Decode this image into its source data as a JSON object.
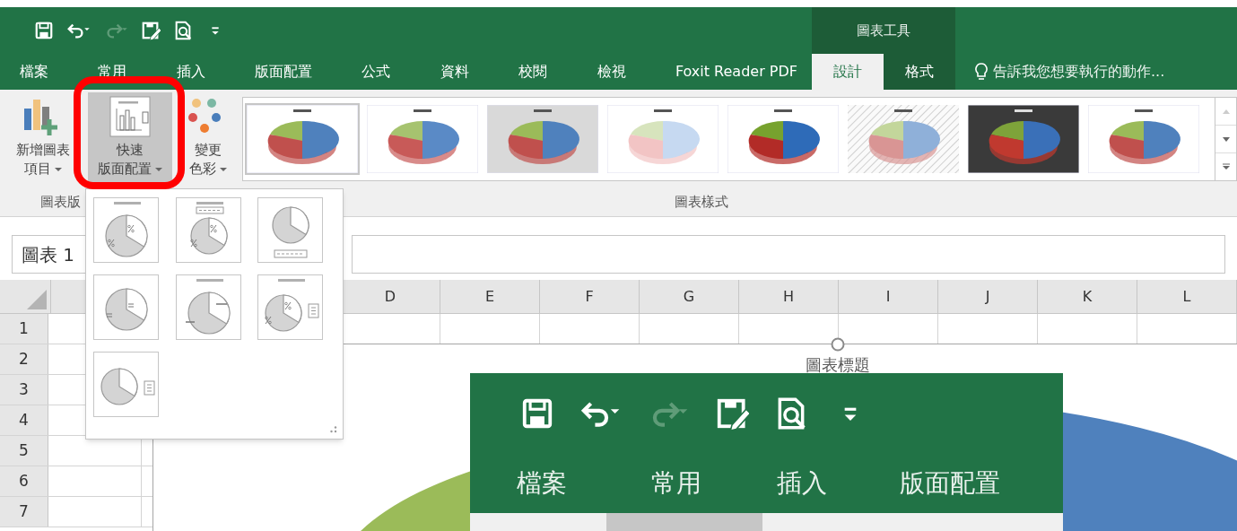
{
  "quick_access": [
    {
      "kind": "save",
      "disabled": false
    },
    {
      "kind": "undo",
      "disabled": false
    },
    {
      "kind": "redo",
      "disabled": true
    },
    {
      "kind": "edit-save",
      "disabled": false
    },
    {
      "kind": "preview",
      "disabled": false
    },
    {
      "kind": "customize",
      "disabled": false
    }
  ],
  "contextual_group": "圖表工具",
  "tabs": [
    {
      "label": "檔案",
      "kind": "normal",
      "selected": false
    },
    {
      "label": "常用",
      "kind": "normal",
      "selected": false
    },
    {
      "label": "插入",
      "kind": "normal",
      "selected": false
    },
    {
      "label": "版面配置",
      "kind": "normal",
      "selected": false
    },
    {
      "label": "公式",
      "kind": "normal",
      "selected": false
    },
    {
      "label": "資料",
      "kind": "normal",
      "selected": false
    },
    {
      "label": "校閱",
      "kind": "normal",
      "selected": false
    },
    {
      "label": "檢視",
      "kind": "normal",
      "selected": false
    },
    {
      "label": "Foxit Reader PDF",
      "kind": "normal",
      "selected": false
    },
    {
      "label": "設計",
      "kind": "contextual",
      "selected": true
    },
    {
      "label": "格式",
      "kind": "contextual",
      "selected": false
    }
  ],
  "tell_me": "告訴我您想要執行的動作...",
  "ribbon_buttons": [
    {
      "kind": "add-element",
      "lines": [
        "新增圖表",
        "項目"
      ],
      "expanded": false
    },
    {
      "kind": "quick-layout",
      "lines": [
        "快速",
        "版面配置"
      ],
      "expanded": true
    },
    {
      "kind": "colors",
      "lines": [
        "變更",
        "色彩"
      ],
      "expanded": false
    }
  ],
  "styles_gallery": [
    {
      "kind": "plain",
      "selected": true
    },
    {
      "kind": "labels",
      "selected": false
    },
    {
      "kind": "gradient",
      "selected": false
    },
    {
      "kind": "pastel",
      "selected": false
    },
    {
      "kind": "bold",
      "selected": false
    },
    {
      "kind": "striped",
      "selected": false
    },
    {
      "kind": "dark",
      "selected": false
    },
    {
      "kind": "callout",
      "selected": false
    }
  ],
  "group_labels": [
    "圖表版",
    "圖表樣式"
  ],
  "name_box": "圖表 1",
  "columns": [
    "D",
    "E",
    "F",
    "G",
    "H",
    "I",
    "J",
    "K",
    "L"
  ],
  "rows": [
    "1",
    "2",
    "3",
    "4",
    "5",
    "6",
    "7"
  ],
  "chart": {
    "title": "圖表標題"
  },
  "layouts": [
    {
      "kind": "title-percent"
    },
    {
      "kind": "title-legend-percent"
    },
    {
      "kind": "legend-bottom"
    },
    {
      "kind": "labels"
    },
    {
      "kind": "title-outside"
    },
    {
      "kind": "title-percent-legend"
    },
    {
      "kind": "legend-right"
    }
  ],
  "annotation": {
    "kind": "highlight"
  },
  "zoom_inset": {
    "quick_access": [
      {
        "kind": "save",
        "disabled": false
      },
      {
        "kind": "undo",
        "disabled": false
      },
      {
        "kind": "redo",
        "disabled": true
      },
      {
        "kind": "edit-save",
        "disabled": false
      },
      {
        "kind": "preview",
        "disabled": false
      },
      {
        "kind": "customize",
        "disabled": false
      }
    ],
    "tabs": [
      {
        "label": "檔案",
        "selected": false
      },
      {
        "label": "常用",
        "selected": false
      },
      {
        "label": "插入",
        "selected": false
      },
      {
        "label": "版面配置",
        "selected": false
      }
    ]
  }
}
